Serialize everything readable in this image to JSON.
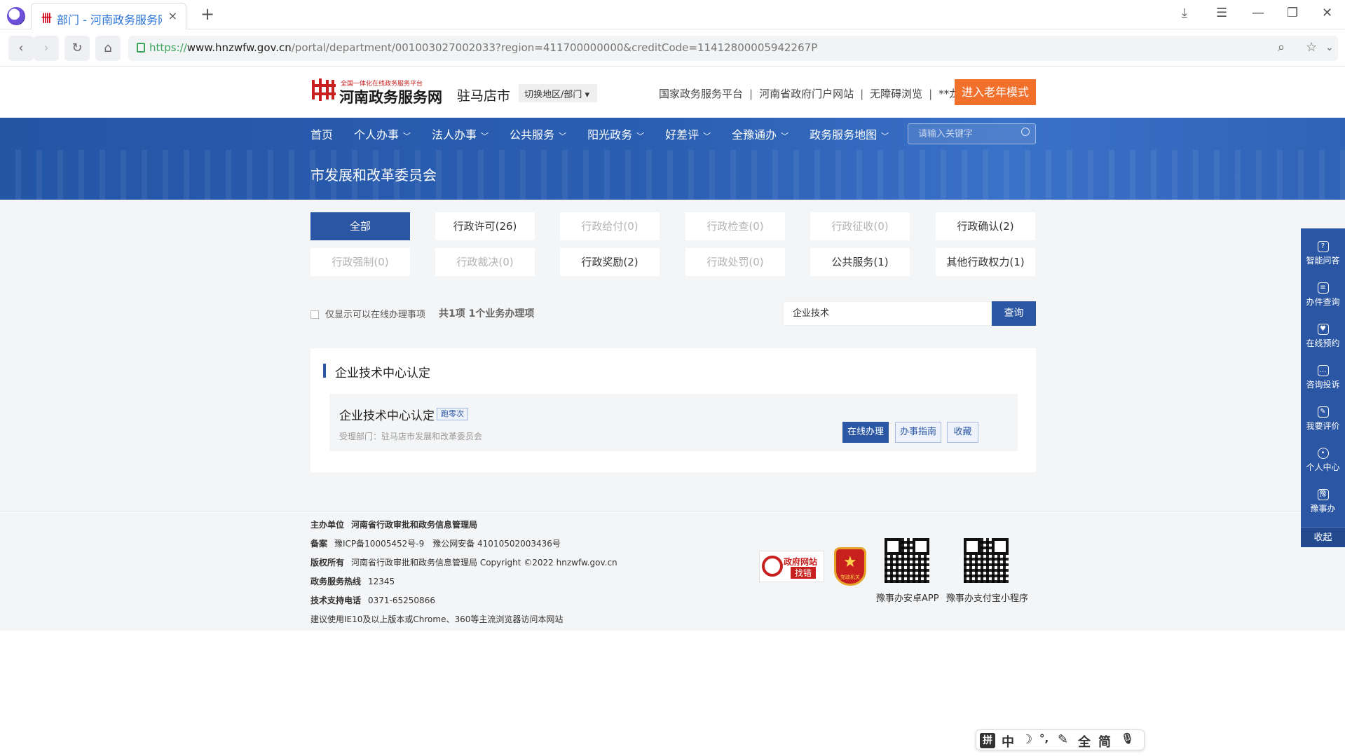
{
  "browser": {
    "tab_title": "部门 - 河南政务服务网",
    "tab_favicon": "卌",
    "new_tab": "+",
    "url_scheme": "https://",
    "url_host": "www.hnzwfw.gov.cn",
    "url_path": "/portal/department/001003027002033?region=411700000000&creditCode=11412800005942267P"
  },
  "header": {
    "logo_sub": "全国一体化在线政务服务平台",
    "logo_main": "河南政务服务网",
    "city": "驻马店市",
    "switch_label": "切换地区/部门 ▾",
    "top_links": [
      "国家政务服务平台",
      "河南省政府门户网站",
      "无障碍浏览"
    ],
    "user": "**龙",
    "elder_mode": "进入老年模式"
  },
  "nav": {
    "items": [
      {
        "label": "首页",
        "dropdown": false
      },
      {
        "label": "个人办事",
        "dropdown": true
      },
      {
        "label": "法人办事",
        "dropdown": true
      },
      {
        "label": "公共服务",
        "dropdown": true
      },
      {
        "label": "阳光政务",
        "dropdown": true
      },
      {
        "label": "好差评",
        "dropdown": true
      },
      {
        "label": "全豫通办",
        "dropdown": true
      },
      {
        "label": "政务服务地图",
        "dropdown": true
      }
    ],
    "search_placeholder": "请输入关键字"
  },
  "department": {
    "title": "市发展和改革委员会"
  },
  "categories": [
    {
      "label": "全部",
      "state": "active"
    },
    {
      "label": "行政许可(26)",
      "state": "normal"
    },
    {
      "label": "行政给付(0)",
      "state": "disabled"
    },
    {
      "label": "行政检查(0)",
      "state": "disabled"
    },
    {
      "label": "行政征收(0)",
      "state": "disabled"
    },
    {
      "label": "行政确认(2)",
      "state": "normal"
    },
    {
      "label": "行政强制(0)",
      "state": "disabled"
    },
    {
      "label": "行政裁决(0)",
      "state": "disabled"
    },
    {
      "label": "行政奖励(2)",
      "state": "normal"
    },
    {
      "label": "行政处罚(0)",
      "state": "disabled"
    },
    {
      "label": "公共服务(1)",
      "state": "normal"
    },
    {
      "label": "其他行政权力(1)",
      "state": "normal"
    }
  ],
  "filter": {
    "online_only_label": "仅显示可以在线办理事项",
    "count_text": "共1项 1个业务办理项",
    "search_value": "企业技术",
    "search_button": "查询"
  },
  "result": {
    "group_title": "企业技术中心认定",
    "item_name": "企业技术中心认定",
    "badge": "跑零次",
    "dept_line": "受理部门：驻马店市发展和改革委员会",
    "btn_online": "在线办理",
    "btn_guide": "办事指南",
    "btn_fav": "收藏"
  },
  "footer": {
    "host_label": "主办单位",
    "host_value": "河南省行政审批和政务信息管理局",
    "record_label": "备案",
    "icp": "豫ICP备10005452号-9",
    "police": "豫公网安备 41010502003436号",
    "copyright_label": "版权所有",
    "copyright_value": "河南省行政审批和政务信息管理局 Copyright ©2022 hnzwfw.gov.cn",
    "hotline_label": "政务服务热线",
    "hotline_value": "12345",
    "support_label": "技术支持电话",
    "support_value": "0371-65250866",
    "browser_note": "建议使用IE10及以上版本或Chrome、360等主流浏览器访问本网站",
    "zfwz_line1": "政府网站",
    "zfwz_line2": "找错",
    "emblem_text": "党政机关",
    "qr1_label": "豫事办安卓APP",
    "qr2_label": "豫事办支付宝小程序"
  },
  "side_panel": {
    "items": [
      {
        "label": "智能问答",
        "icon": "qa-icon"
      },
      {
        "label": "办件查询",
        "icon": "search-doc-icon"
      },
      {
        "label": "在线预约",
        "icon": "calendar-icon"
      },
      {
        "label": "咨询投诉",
        "icon": "chat-icon"
      },
      {
        "label": "我要评价",
        "icon": "edit-icon"
      },
      {
        "label": "个人中心",
        "icon": "user-icon"
      },
      {
        "label": "豫事办",
        "icon": "app-icon"
      }
    ],
    "collapse": "收起"
  },
  "ime": {
    "items": [
      "拼",
      "中",
      "☽",
      "°,",
      "✎",
      "全",
      "简",
      "🎙"
    ]
  }
}
